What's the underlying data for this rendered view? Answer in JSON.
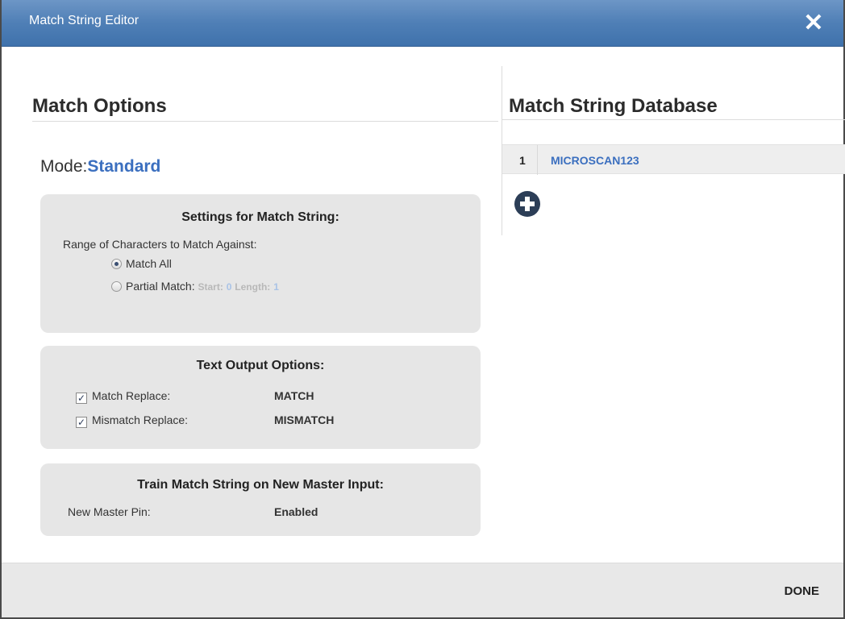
{
  "window": {
    "title": "Match String Editor",
    "close_glyph": "✕"
  },
  "match_options": {
    "heading": "Match Options",
    "mode_label": "Mode:",
    "mode_value": "Standard",
    "settings_panel": {
      "title": "Settings for Match String:",
      "range_label": "Range of Characters to Match Against:",
      "option_all": "Match All",
      "option_partial": "Partial Match:",
      "start_label": "Start:",
      "start_value": "0",
      "length_label": "Length:",
      "length_value": "1",
      "selected": "Match All"
    },
    "text_output_panel": {
      "title": "Text Output Options:",
      "match_replace_label": "Match Replace:",
      "match_replace_value": "MATCH",
      "match_replace_checked": true,
      "mismatch_replace_label": "Mismatch Replace:",
      "mismatch_replace_value": "MISMATCH",
      "mismatch_replace_checked": true,
      "check_glyph": "✓"
    },
    "train_panel": {
      "title": "Train Match String on New Master Input:",
      "pin_label": "New Master Pin:",
      "pin_value": "Enabled"
    }
  },
  "database": {
    "heading": "Match String Database",
    "rows": [
      {
        "index": "1",
        "value": "MICROSCAN123"
      }
    ],
    "add_icon": "plus-circle-icon"
  },
  "footer": {
    "done_label": "DONE"
  },
  "colors": {
    "accent": "#3b6fbf",
    "titlebar": "#4f7fb6",
    "panel": "#e6e6e6"
  }
}
